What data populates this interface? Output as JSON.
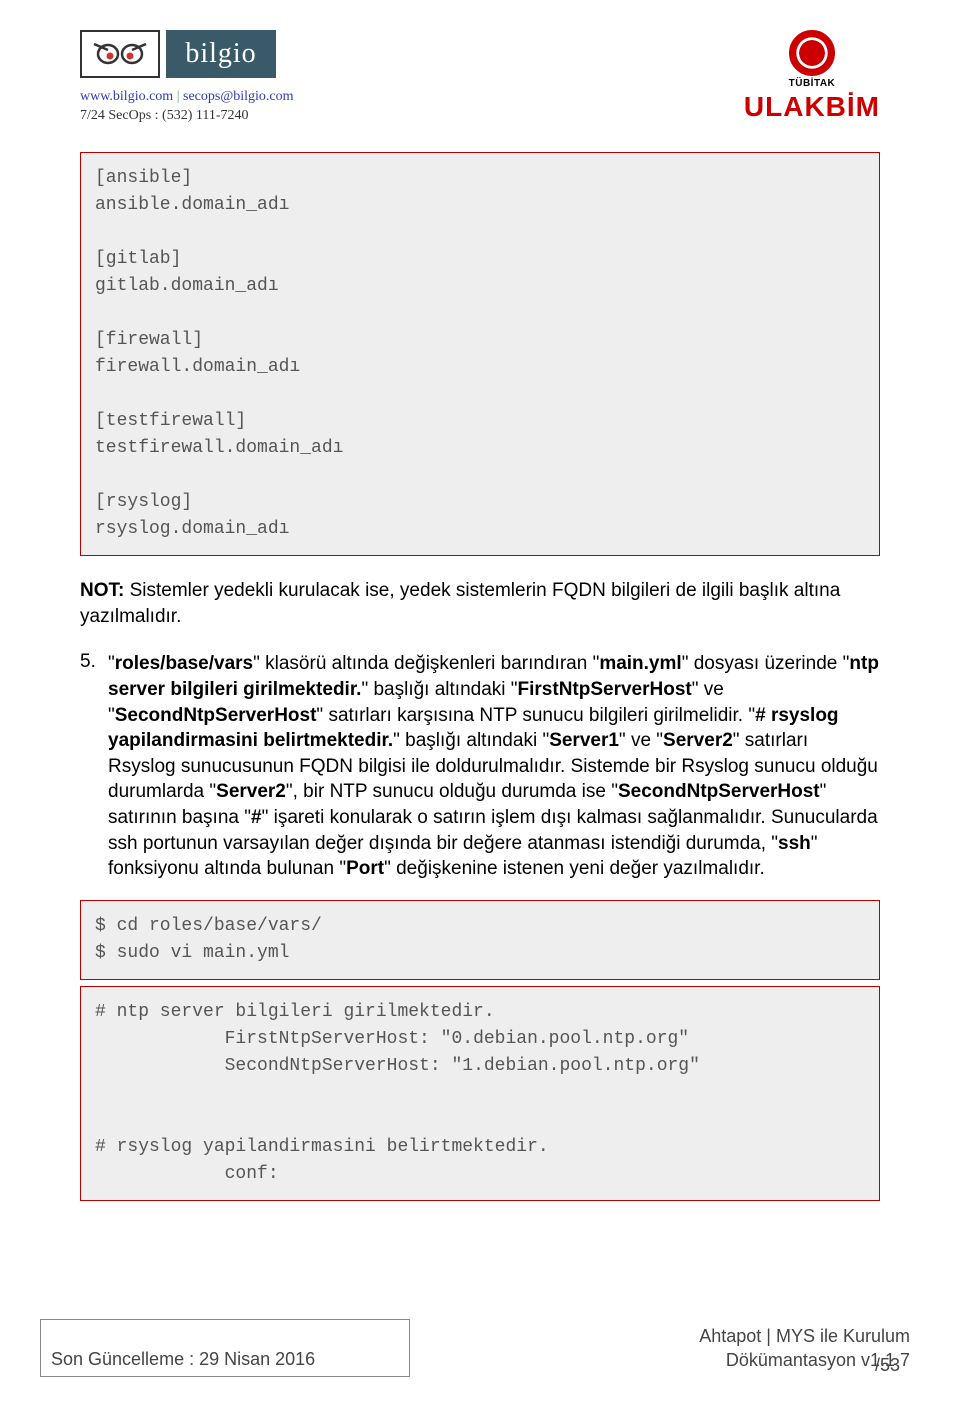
{
  "header": {
    "bilgio_logo_text": "bilgio",
    "contact_url": "www.bilgio.com",
    "contact_sep": " | ",
    "contact_email": "secops@bilgio.com",
    "secops_line": "7/24 SecOps : (532) 111-7240",
    "tubitak_label": "TÜBİTAK",
    "ulakbim": "ULAKBİM"
  },
  "code_block_1": "[ansible]\nansible.domain_adı\n\n[gitlab]\ngitlab.domain_adı\n\n[firewall]\nfirewall.domain_adı\n\n[testfirewall]\ntestfirewall.domain_adı\n\n[rsyslog]\nrsyslog.domain_adı",
  "note": {
    "label": "NOT:",
    "text": " Sistemler yedekli kurulacak ise, yedek sistemlerin FQDN bilgileri de ilgili başlık altına yazılmalıdır."
  },
  "item5": {
    "num": "5.",
    "seg1": "\"",
    "bold1": "roles/base/vars",
    "seg2": "\" klasörü altında değişkenleri barındıran \"",
    "bold2": "main.yml",
    "seg3": "\" dosyası üzerinde \"",
    "bold3": "ntp server bilgileri girilmektedir.",
    "seg4": "\" başlığı altındaki \"",
    "bold4": "FirstNtpServerHost",
    "seg5": "\" ve \"",
    "bold5": "SecondNtpServerHost",
    "seg6": "\" satırları karşısına NTP sunucu bilgileri girilmelidir. \"",
    "bold6": "# rsyslog yapilandirmasini belirtmektedir.",
    "seg7": "\" başlığı altındaki \"",
    "bold7": "Server1",
    "seg8": "\" ve \"",
    "bold8": "Server2",
    "seg9": "\" satırları Rsyslog sunucusunun FQDN bilgisi ile doldurulmalıdır. Sistemde bir Rsyslog sunucu olduğu durumlarda \"",
    "bold9": "Server2",
    "seg10": "\", bir NTP sunucu olduğu durumda ise \"",
    "bold10": "SecondNtpServerHost",
    "seg11": "\" satırının başına \"",
    "bold11": "#",
    "seg12": "\" işareti konularak o satırın işlem dışı kalması sağlanmalıdır. Sunucularda ssh portunun varsayılan değer dışında bir değere atanması istendiği durumda, \"",
    "bold12": "ssh",
    "seg13": "\" fonksiyonu altında bulunan \"",
    "bold13": "Port",
    "seg14": "\" değişkenine istenen yeni değer yazılmalıdır."
  },
  "code_block_2": "$ cd roles/base/vars/\n$ sudo vi main.yml",
  "code_block_3": "# ntp server bilgileri girilmektedir.\n            FirstNtpServerHost: \"0.debian.pool.ntp.org\"\n            SecondNtpServerHost: \"1.debian.pool.ntp.org\"\n\n\n# rsyslog yapilandirmasini belirtmektedir.\n            conf:",
  "footer": {
    "left": "Son Güncelleme : 29 Nisan 2016",
    "right_line1": "Ahtapot | MYS ile Kurulum",
    "right_line2": "Dökümantasyon v1.1 7",
    "page_frac": "/53"
  }
}
